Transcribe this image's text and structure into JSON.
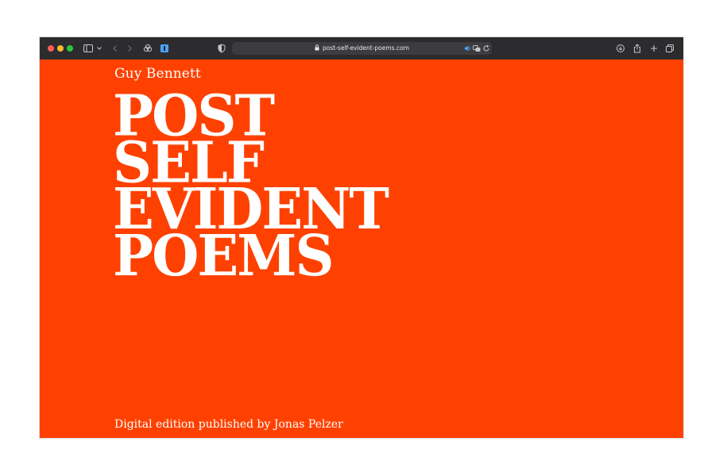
{
  "browser": {
    "url": "post-self-evident-poems.com",
    "traffic_colors": [
      "#fe5f57",
      "#febc2e",
      "#28c840"
    ],
    "icons": [
      "sidebar-icon",
      "chevron-down-icon",
      "back-icon",
      "forward-icon",
      "extensions-icon",
      "password-icon",
      "shield-icon",
      "lock-icon",
      "audio-icon",
      "translate-icon",
      "reload-icon",
      "download-icon",
      "share-icon",
      "new-tab-icon",
      "tab-overview-icon"
    ]
  },
  "page": {
    "background": "#fe4100",
    "author": "Guy Bennett",
    "title_lines": [
      "POST",
      "SELF",
      "EVIDENT",
      "POEMS"
    ],
    "publisher": "Digital edition published by Jonas Pelzer"
  }
}
